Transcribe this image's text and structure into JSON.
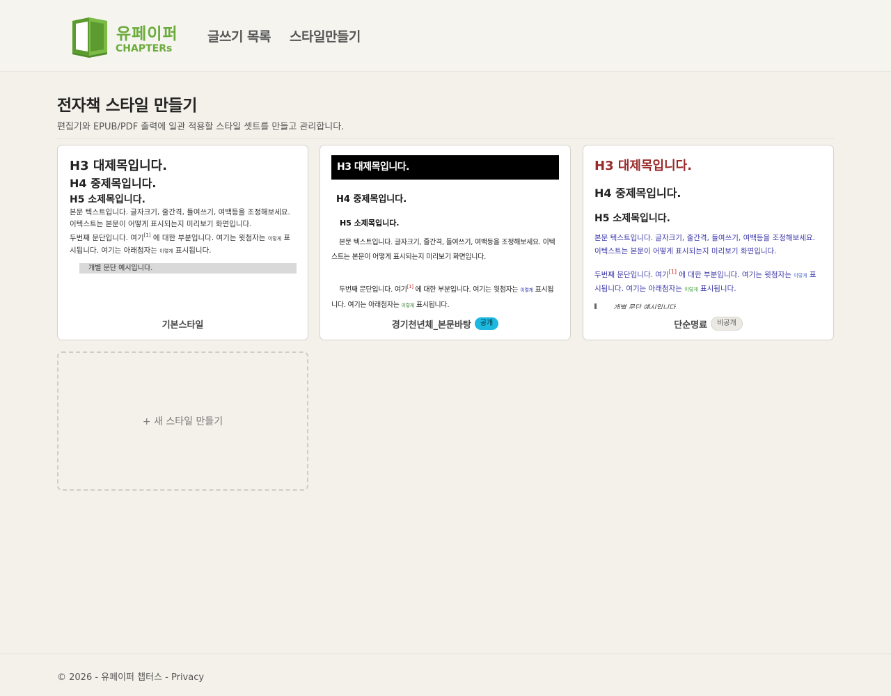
{
  "brand": {
    "name_kr": "유페이퍼",
    "name_en": "CHAPTERs"
  },
  "nav": {
    "items": [
      {
        "label": "글쓰기 목록"
      },
      {
        "label": "스타일만들기"
      }
    ]
  },
  "page": {
    "title": "전자책 스타일 만들기",
    "subtitle": "편집기와 EPUB/PDF 출력에 일관 적용할 스타일 셋트를 만들고 관리합니다."
  },
  "preview_text": {
    "h3": "H3 대제목입니다.",
    "h4": "H4 중제목입니다.",
    "h5": "H5 소제목입니다.",
    "p1": "본문 텍스트입니다. 글자크기, 줄간격, 들여쓰기, 여백등을 조정해보세요. 이텍스트는 본문이 어떻게 표시되는지 미리보기 화면입니다.",
    "p2_a": "두번째 문단입니다. 여기",
    "p2_fn": "[1]",
    "p2_b": " 에 대한 부분입니다. 여기는 윗첨자는 ",
    "p2_sup": "이렇게",
    "p2_c": " 표시됩니다. 여기는 아래첨자는 ",
    "p2_sub": "이렇게",
    "p2_d": " 표시됩니다.",
    "box": "개별 문단 예시입니다."
  },
  "styles": [
    {
      "name": "기본스타일",
      "badge": ""
    },
    {
      "name": "경기천년체_본문바탕",
      "badge": "공개"
    },
    {
      "name": "단순명료",
      "badge": "비공개"
    }
  ],
  "new_style": {
    "label": "+ 새 스타일 만들기"
  },
  "footer": {
    "copyright": "© 2026 - 유페이퍼 챕터스 - ",
    "privacy": "Privacy"
  },
  "colors": {
    "brand_green": "#6aab3a",
    "badge_public": "#1cb8e0",
    "simple_h3": "#9a2a2a",
    "simple_body": "#3a36a8"
  }
}
